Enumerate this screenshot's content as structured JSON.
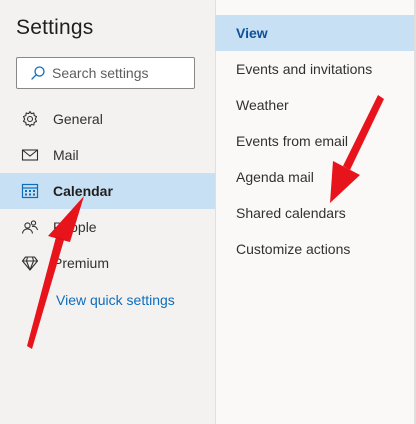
{
  "settings": {
    "title": "Settings",
    "search_placeholder": "Search settings"
  },
  "nav": {
    "items": [
      {
        "label": "General",
        "icon": "gear-icon",
        "active": false
      },
      {
        "label": "Mail",
        "icon": "mail-icon",
        "active": false
      },
      {
        "label": "Calendar",
        "icon": "calendar-icon",
        "active": true
      },
      {
        "label": "People",
        "icon": "people-icon",
        "active": false
      },
      {
        "label": "Premium",
        "icon": "diamond-icon",
        "active": false
      }
    ],
    "quick_settings": "View quick settings"
  },
  "calendar_sections": {
    "items": [
      {
        "label": "View",
        "active": true
      },
      {
        "label": "Events and invitations",
        "active": false
      },
      {
        "label": "Weather",
        "active": false
      },
      {
        "label": "Events from email",
        "active": false
      },
      {
        "label": "Agenda mail",
        "active": false
      },
      {
        "label": "Shared calendars",
        "active": false
      },
      {
        "label": "Customize actions",
        "active": false
      }
    ]
  },
  "colors": {
    "accent": "#0f6cbd",
    "selected_bg": "#c7e0f4",
    "annotation_arrow": "#e8141c"
  }
}
